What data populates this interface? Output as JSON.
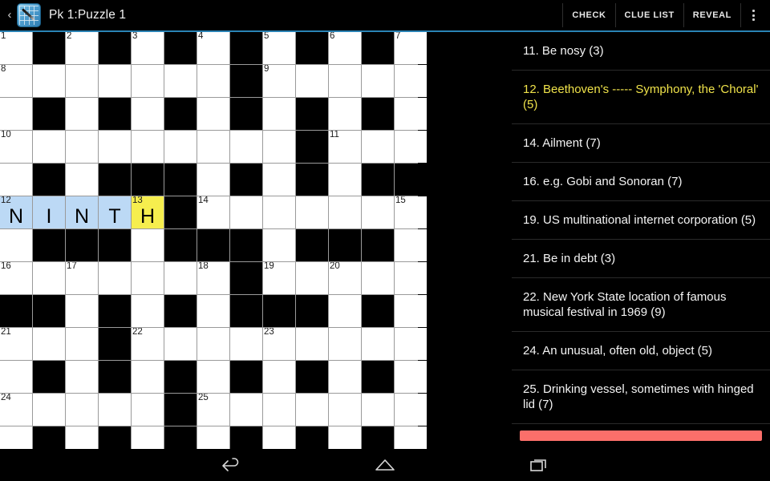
{
  "actionbar": {
    "back_glyph": "‹",
    "app_icon": "crossword-app-icon",
    "title": "Pk 1:Puzzle 1",
    "buttons": [
      {
        "name": "check",
        "label": "CHECK"
      },
      {
        "name": "clue-list",
        "label": "CLUE LIST"
      },
      {
        "name": "reveal",
        "label": "REVEAL"
      }
    ],
    "overflow": "overflow-menu-icon"
  },
  "grid": {
    "columns": 13,
    "rows": 13,
    "cell_size_px": 40,
    "colors": {
      "empty": "#ffffff",
      "block": "#000000",
      "highlight": "#bcd9f5",
      "cursor": "#f6ee4e",
      "border": "#9a9a9a"
    },
    "cells": [
      [
        {
          "t": "w",
          "n": "1"
        },
        {
          "t": "b"
        },
        {
          "t": "w",
          "n": "2"
        },
        {
          "t": "b"
        },
        {
          "t": "w",
          "n": "3"
        },
        {
          "t": "b"
        },
        {
          "t": "w",
          "n": "4"
        },
        {
          "t": "b"
        },
        {
          "t": "w",
          "n": "5"
        },
        {
          "t": "b"
        },
        {
          "t": "w",
          "n": "6"
        },
        {
          "t": "b"
        },
        {
          "t": "w",
          "n": "7"
        }
      ],
      [
        {
          "t": "w",
          "n": "8"
        },
        {
          "t": "w"
        },
        {
          "t": "w"
        },
        {
          "t": "w"
        },
        {
          "t": "w"
        },
        {
          "t": "w"
        },
        {
          "t": "w"
        },
        {
          "t": "b"
        },
        {
          "t": "w",
          "n": "9"
        },
        {
          "t": "w"
        },
        {
          "t": "w"
        },
        {
          "t": "w"
        },
        {
          "t": "w"
        }
      ],
      [
        {
          "t": "w"
        },
        {
          "t": "b"
        },
        {
          "t": "w"
        },
        {
          "t": "b"
        },
        {
          "t": "w"
        },
        {
          "t": "b"
        },
        {
          "t": "w"
        },
        {
          "t": "b"
        },
        {
          "t": "w"
        },
        {
          "t": "b"
        },
        {
          "t": "w"
        },
        {
          "t": "b"
        },
        {
          "t": "w"
        }
      ],
      [
        {
          "t": "w",
          "n": "10"
        },
        {
          "t": "w"
        },
        {
          "t": "w"
        },
        {
          "t": "w"
        },
        {
          "t": "w"
        },
        {
          "t": "w"
        },
        {
          "t": "w"
        },
        {
          "t": "w"
        },
        {
          "t": "w"
        },
        {
          "t": "b"
        },
        {
          "t": "w",
          "n": "11"
        },
        {
          "t": "w"
        },
        {
          "t": "w"
        }
      ],
      [
        {
          "t": "w"
        },
        {
          "t": "b"
        },
        {
          "t": "w"
        },
        {
          "t": "b"
        },
        {
          "t": "b"
        },
        {
          "t": "b"
        },
        {
          "t": "w"
        },
        {
          "t": "b"
        },
        {
          "t": "w"
        },
        {
          "t": "b"
        },
        {
          "t": "w"
        },
        {
          "t": "b"
        },
        {
          "t": "b"
        }
      ],
      [
        {
          "t": "h",
          "n": "12",
          "l": "N"
        },
        {
          "t": "h",
          "l": "I"
        },
        {
          "t": "h",
          "l": "N"
        },
        {
          "t": "h",
          "l": "T"
        },
        {
          "t": "c",
          "n": "13",
          "l": "H"
        },
        {
          "t": "b"
        },
        {
          "t": "w",
          "n": "14"
        },
        {
          "t": "w"
        },
        {
          "t": "w"
        },
        {
          "t": "w"
        },
        {
          "t": "w"
        },
        {
          "t": "w"
        },
        {
          "t": "w",
          "n": "15"
        }
      ],
      [
        {
          "t": "w"
        },
        {
          "t": "b"
        },
        {
          "t": "b"
        },
        {
          "t": "b"
        },
        {
          "t": "w"
        },
        {
          "t": "b"
        },
        {
          "t": "b"
        },
        {
          "t": "b"
        },
        {
          "t": "w"
        },
        {
          "t": "b"
        },
        {
          "t": "b"
        },
        {
          "t": "b"
        },
        {
          "t": "w"
        }
      ],
      [
        {
          "t": "w",
          "n": "16"
        },
        {
          "t": "w"
        },
        {
          "t": "w",
          "n": "17"
        },
        {
          "t": "w"
        },
        {
          "t": "w"
        },
        {
          "t": "w"
        },
        {
          "t": "w",
          "n": "18"
        },
        {
          "t": "b"
        },
        {
          "t": "w",
          "n": "19"
        },
        {
          "t": "w"
        },
        {
          "t": "w",
          "n": "20"
        },
        {
          "t": "w"
        },
        {
          "t": "w"
        }
      ],
      [
        {
          "t": "b"
        },
        {
          "t": "b"
        },
        {
          "t": "w"
        },
        {
          "t": "b"
        },
        {
          "t": "w"
        },
        {
          "t": "b"
        },
        {
          "t": "w"
        },
        {
          "t": "b"
        },
        {
          "t": "b"
        },
        {
          "t": "b"
        },
        {
          "t": "w"
        },
        {
          "t": "b"
        },
        {
          "t": "w"
        }
      ],
      [
        {
          "t": "w",
          "n": "21"
        },
        {
          "t": "w"
        },
        {
          "t": "w"
        },
        {
          "t": "b"
        },
        {
          "t": "w",
          "n": "22"
        },
        {
          "t": "w"
        },
        {
          "t": "w"
        },
        {
          "t": "w"
        },
        {
          "t": "w",
          "n": "23"
        },
        {
          "t": "w"
        },
        {
          "t": "w"
        },
        {
          "t": "w"
        },
        {
          "t": "w"
        }
      ],
      [
        {
          "t": "w"
        },
        {
          "t": "b"
        },
        {
          "t": "w"
        },
        {
          "t": "b"
        },
        {
          "t": "w"
        },
        {
          "t": "b"
        },
        {
          "t": "w"
        },
        {
          "t": "b"
        },
        {
          "t": "w"
        },
        {
          "t": "b"
        },
        {
          "t": "w"
        },
        {
          "t": "b"
        },
        {
          "t": "w"
        }
      ],
      [
        {
          "t": "w",
          "n": "24"
        },
        {
          "t": "w"
        },
        {
          "t": "w"
        },
        {
          "t": "w"
        },
        {
          "t": "w"
        },
        {
          "t": "b"
        },
        {
          "t": "w",
          "n": "25"
        },
        {
          "t": "w"
        },
        {
          "t": "w"
        },
        {
          "t": "w"
        },
        {
          "t": "w"
        },
        {
          "t": "w"
        },
        {
          "t": "w"
        }
      ],
      [
        {
          "t": "w"
        },
        {
          "t": "b"
        },
        {
          "t": "w"
        },
        {
          "t": "b"
        },
        {
          "t": "w"
        },
        {
          "t": "b"
        },
        {
          "t": "w"
        },
        {
          "t": "b"
        },
        {
          "t": "w"
        },
        {
          "t": "b"
        },
        {
          "t": "w"
        },
        {
          "t": "b"
        },
        {
          "t": "w"
        }
      ]
    ]
  },
  "clues": [
    {
      "text": "11. Be nosy (3)",
      "active": false
    },
    {
      "text": "12. Beethoven's ----- Symphony, the 'Choral' (5)",
      "active": true
    },
    {
      "text": "14. Ailment (7)",
      "active": false
    },
    {
      "text": "16. e.g. Gobi and Sonoran (7)",
      "active": false
    },
    {
      "text": "19. US multinational internet corporation (5)",
      "active": false
    },
    {
      "text": "21. Be in debt (3)",
      "active": false
    },
    {
      "text": "22. New York State location of famous musical festival in 1969 (9)",
      "active": false
    },
    {
      "text": "24. An unusual, often old, object (5)",
      "active": false
    },
    {
      "text": "25. Drinking vessel, sometimes with hinged lid (7)",
      "active": false
    }
  ],
  "clue_progress": {
    "color": "#fb6f6a"
  },
  "navbar": {
    "back": "back-icon",
    "home": "home-icon",
    "recents": "recent-apps-icon"
  }
}
